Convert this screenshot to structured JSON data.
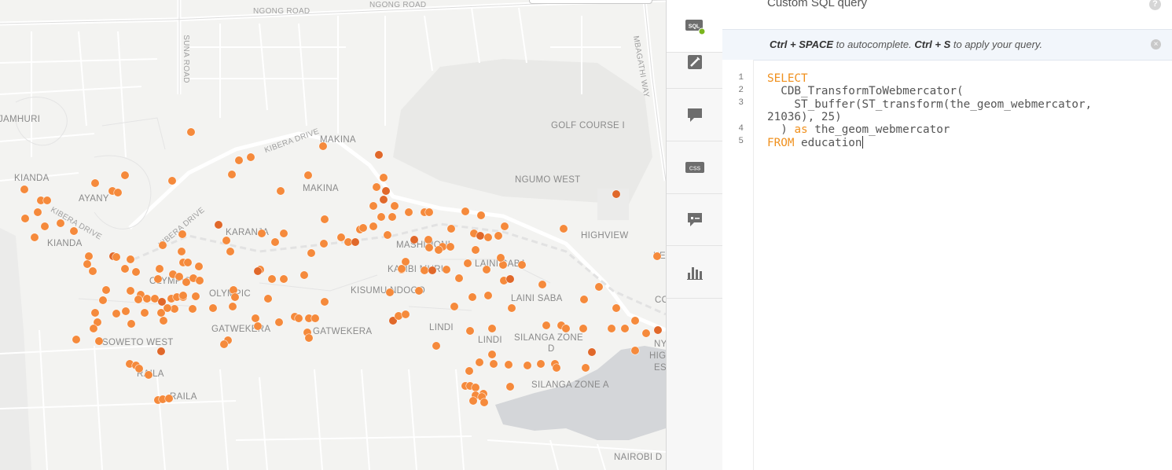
{
  "map": {
    "labels": {
      "ngong_road_1": "NGONG ROAD",
      "ngong_road_2": "NGONG ROAD",
      "suna_road": "SUNA ROAD",
      "mbagathi_way": "MBAGATHI WAY",
      "jamhuri": "JAMHURI",
      "kibera_drive_1": "KIBERA DRIVE",
      "kibera_drive_2": "KIBERA DRIVE",
      "kibera_drive_3": "KIBERA DRIVE",
      "makina_1": "MAKINA",
      "makina_2": "MAKINA",
      "golf_course": "GOLF COURSE I",
      "kianda_1": "KIANDA",
      "kianda_2": "KIANDA",
      "ayany": "AYANY",
      "ngumo_west": "NGUMO WEST",
      "karanja": "KARANJA",
      "mashimoni": "MASHIMONI",
      "highview": "HIGHVIEW",
      "ke": "KE",
      "laini_saba_1": "LAINI SABA",
      "laini_saba_2": "LAINI SABA",
      "kambi_muru": "KAMBI MURU",
      "olympic_1": "OLYMPIC",
      "olympic_2": "OLYMPIC",
      "kisumu_ndogo": "KISUMU NDOGO",
      "co": "CO",
      "gatwekera_1": "GATWEKERA",
      "gatwekera_2": "GATWEKERA",
      "lindi_1": "LINDI",
      "lindi_2": "LINDI",
      "silanga_zone_d": "SILANGA ZONE",
      "silanga_zone_d2": "D",
      "soweto_west": "SOWETO WEST",
      "ny": "NY",
      "hig": "HIG",
      "es": "ES",
      "raila_1": "RAILA",
      "raila_2": "RAILA",
      "silanga_zone_a": "SILANGA ZONE A",
      "nairobi_d": "NAIROBI D"
    }
  },
  "toolbar": {
    "items": [
      {
        "icon": "sql-icon",
        "label": "SQL",
        "active": true
      },
      {
        "icon": "wizard-icon",
        "active": false
      },
      {
        "icon": "infowindow-icon",
        "active": false
      },
      {
        "icon": "css-icon",
        "label": "CSS",
        "active": false
      },
      {
        "icon": "legends-icon",
        "active": false
      },
      {
        "icon": "filters-icon",
        "active": false
      }
    ]
  },
  "panel": {
    "title": "Custom SQL query",
    "help": "?",
    "hint": {
      "shortcut1": "Ctrl + SPACE",
      "text1": " to autocomplete. ",
      "shortcut2": "Ctrl + S",
      "text2": " to apply your query."
    },
    "close": "×",
    "line_numbers": [
      "1",
      "2",
      "3",
      "4",
      "5"
    ],
    "code": {
      "l1_kw": "SELECT",
      "l2": "  CDB_TransformToWebmercator(",
      "l3": "    ST_buffer(ST_transform(the_geom_webmercator,",
      "l3b": "21036), 25)",
      "l4a": "  ) ",
      "l4_kw": "as",
      "l4b": " the_geom_webmercator",
      "l5_kw": "FROM",
      "l5b": " education"
    }
  },
  "colors": {
    "dot": "#f58a3c",
    "dot_dark": "#e0682a",
    "keyword": "#f0901d"
  }
}
